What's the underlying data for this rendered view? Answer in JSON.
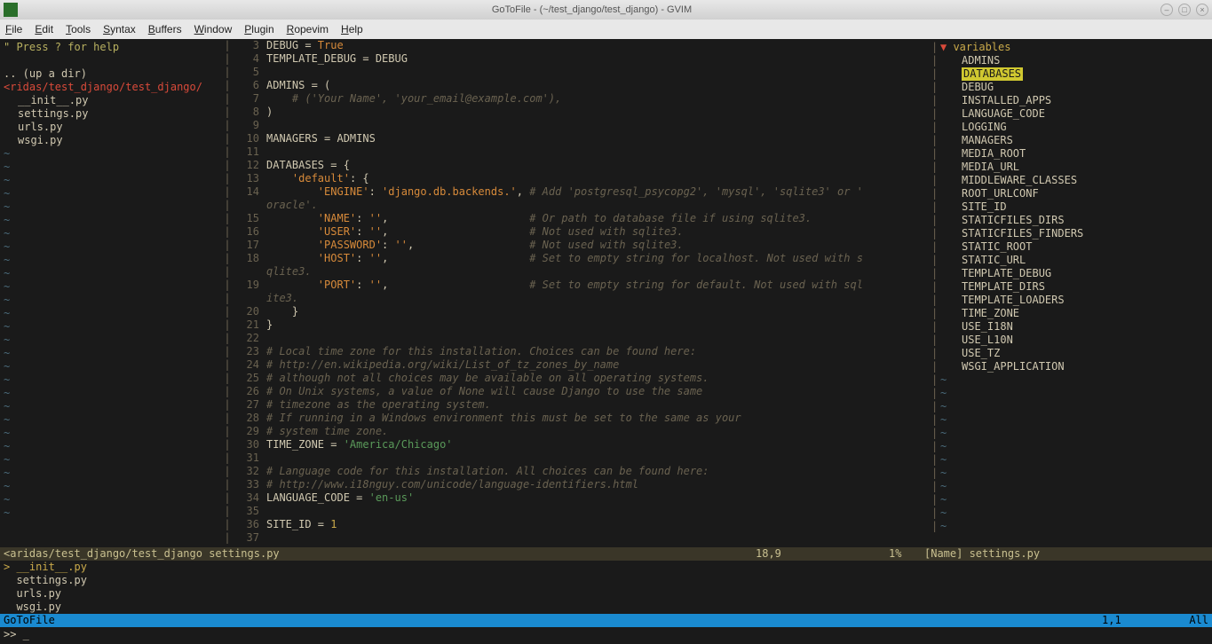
{
  "window": {
    "title": "GoToFile - (~/test_django/test_django) - GVIM"
  },
  "menu": [
    "File",
    "Edit",
    "Tools",
    "Syntax",
    "Buffers",
    "Window",
    "Plugin",
    "Ropevim",
    "Help"
  ],
  "sidebar": {
    "hint": "\" Press ? for help",
    "updir": ".. (up a dir)",
    "path": "<ridas/test_django/test_django/",
    "files": [
      "__init__.py",
      "settings.py",
      "urls.py",
      "wsgi.py"
    ]
  },
  "code": {
    "lines": [
      {
        "n": 3,
        "html": "DEBUG = <span class='bool'>True</span>"
      },
      {
        "n": 4,
        "html": "TEMPLATE_DEBUG = DEBUG"
      },
      {
        "n": 5,
        "html": ""
      },
      {
        "n": 6,
        "html": "ADMINS = ("
      },
      {
        "n": 7,
        "html": "    <span class='cmt'># ('Your Name', 'your_email@example.com'),</span>"
      },
      {
        "n": 8,
        "html": ")"
      },
      {
        "n": 9,
        "html": ""
      },
      {
        "n": 10,
        "html": "MANAGERS = ADMINS"
      },
      {
        "n": 11,
        "html": ""
      },
      {
        "n": 12,
        "html": "DATABASES = {"
      },
      {
        "n": 13,
        "html": "    <span class='str2'>'default'</span>: {"
      },
      {
        "n": 14,
        "html": "        <span class='str2'>'ENGINE'</span>: <span class='str2'>'django.db.backends.'</span>, <span class='cmt'># Add 'postgresql_psycopg2', 'mysql', 'sqlite3' or '</span>"
      },
      {
        "n": "",
        "html": "<span class='cmt'>oracle'.</span>"
      },
      {
        "n": 15,
        "html": "        <span class='str2'>'NAME'</span>: <span class='str2'>''</span>,                      <span class='cmt'># Or path to database file if using sqlite3.</span>"
      },
      {
        "n": 16,
        "html": "        <span class='str2'>'USER'</span>: <span class='str2'>''</span>,                      <span class='cmt'># Not used with sqlite3.</span>"
      },
      {
        "n": 17,
        "html": "        <span class='str2'>'PASSWORD'</span>: <span class='str2'>''</span>,                  <span class='cmt'># Not used with sqlite3.</span>"
      },
      {
        "n": 18,
        "html": "        <span class='str2'>'HOST'</span>: <span class='str2'>''</span>,                      <span class='cmt'># Set to empty string for localhost. Not used with s</span>"
      },
      {
        "n": "",
        "html": "<span class='cmt'>qlite3.</span>"
      },
      {
        "n": 19,
        "html": "        <span class='str2'>'PORT'</span>: <span class='str2'>''</span>,                      <span class='cmt'># Set to empty string for default. Not used with sql</span>"
      },
      {
        "n": "",
        "html": "<span class='cmt'>ite3.</span>"
      },
      {
        "n": 20,
        "html": "    }"
      },
      {
        "n": 21,
        "html": "}"
      },
      {
        "n": 22,
        "html": ""
      },
      {
        "n": 23,
        "html": "<span class='cmt'># Local time zone for this installation. Choices can be found here:</span>"
      },
      {
        "n": 24,
        "html": "<span class='cmt'># http://en.wikipedia.org/wiki/List_of_tz_zones_by_name</span>"
      },
      {
        "n": 25,
        "html": "<span class='cmt'># although not all choices may be available on all operating systems.</span>"
      },
      {
        "n": 26,
        "html": "<span class='cmt'># On Unix systems, a value of None will cause Django to use the same</span>"
      },
      {
        "n": 27,
        "html": "<span class='cmt'># timezone as the operating system.</span>"
      },
      {
        "n": 28,
        "html": "<span class='cmt'># If running in a Windows environment this must be set to the same as your</span>"
      },
      {
        "n": 29,
        "html": "<span class='cmt'># system time zone.</span>"
      },
      {
        "n": 30,
        "html": "TIME_ZONE = <span class='str'>'America/Chicago'</span>"
      },
      {
        "n": 31,
        "html": ""
      },
      {
        "n": 32,
        "html": "<span class='cmt'># Language code for this installation. All choices can be found here:</span>"
      },
      {
        "n": 33,
        "html": "<span class='cmt'># http://www.i18nguy.com/unicode/language-identifiers.html</span>"
      },
      {
        "n": 34,
        "html": "LANGUAGE_CODE = <span class='str'>'en-us'</span>"
      },
      {
        "n": 35,
        "html": ""
      },
      {
        "n": 36,
        "html": "SITE_ID = <span class='num'>1</span>"
      },
      {
        "n": 37,
        "html": ""
      }
    ]
  },
  "taglist": {
    "header": "variables",
    "items": [
      "ADMINS",
      "DATABASES",
      "DEBUG",
      "INSTALLED_APPS",
      "LANGUAGE_CODE",
      "LOGGING",
      "MANAGERS",
      "MEDIA_ROOT",
      "MEDIA_URL",
      "MIDDLEWARE_CLASSES",
      "ROOT_URLCONF",
      "SITE_ID",
      "STATICFILES_DIRS",
      "STATICFILES_FINDERS",
      "STATIC_ROOT",
      "STATIC_URL",
      "TEMPLATE_DEBUG",
      "TEMPLATE_DIRS",
      "TEMPLATE_LOADERS",
      "TIME_ZONE",
      "USE_I18N",
      "USE_L10N",
      "USE_TZ",
      "WSGI_APPLICATION"
    ],
    "selected": "DATABASES"
  },
  "status": {
    "main_left": "<aridas/test_django/test_django settings.py",
    "main_pos": "18,9",
    "main_pct": "1%",
    "main_right": "[Name] settings.py"
  },
  "gotofile": {
    "items": [
      "__init__.py",
      "settings.py",
      "urls.py",
      "wsgi.py"
    ],
    "bar_left": "GoToFile",
    "bar_pos": "1,1",
    "bar_pct": "All"
  },
  "cmdline": ">> _"
}
